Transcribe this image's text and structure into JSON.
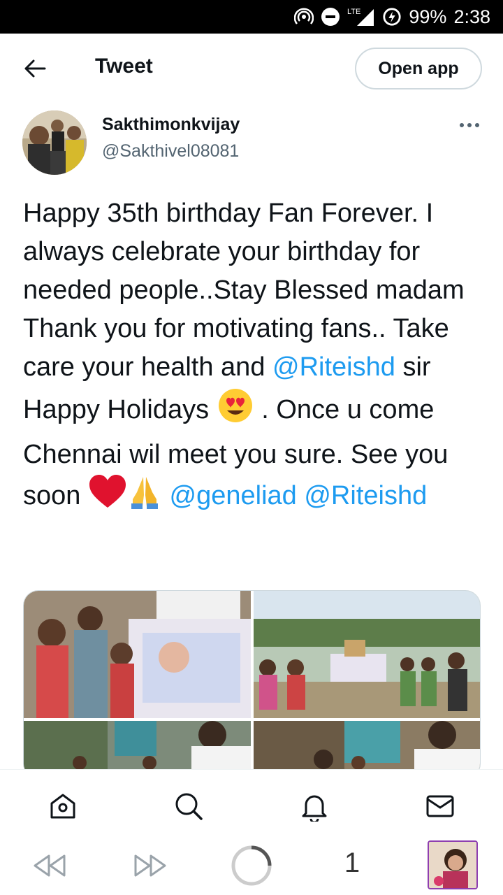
{
  "status_bar": {
    "network": "LTE",
    "battery": "99%",
    "time": "2:38"
  },
  "header": {
    "title": "Tweet",
    "open_app_label": "Open app"
  },
  "author": {
    "display_name": "Sakthimonkvijay",
    "handle": "@Sakthivel08081"
  },
  "tweet": {
    "segments": [
      {
        "type": "text",
        "text": "Happy 35th birthday Fan Forever. I  always celebrate your birthday for needed people..Stay Blessed madam Thank you for motivating fans.. Take care your health and "
      },
      {
        "type": "mention",
        "text": "@Riteishd"
      },
      {
        "type": "text",
        "text": " sir Happy Holidays "
      },
      {
        "type": "emoji",
        "name": "heart-eyes-emoji"
      },
      {
        "type": "text",
        "text": " . Once u come Chennai wil meet you sure. See you soon "
      },
      {
        "type": "emoji",
        "name": "red-heart-emoji"
      },
      {
        "type": "emoji",
        "name": "folded-hands-emoji"
      },
      {
        "type": "text",
        "text": " "
      },
      {
        "type": "mention",
        "text": "@geneliad"
      },
      {
        "type": "text",
        "text": " "
      },
      {
        "type": "mention",
        "text": "@Riteishd"
      }
    ]
  },
  "media": {
    "count": 4,
    "photos": [
      {
        "name": "photo-children-with-poster"
      },
      {
        "name": "photo-group-village-banner"
      },
      {
        "name": "photo-man-distributing"
      },
      {
        "name": "photo-man-giving-gift"
      }
    ]
  },
  "bottom_nav": {
    "items": [
      "home-icon",
      "search-icon",
      "notifications-icon",
      "messages-icon"
    ]
  },
  "browser_bar": {
    "tab_count": "1"
  },
  "colors": {
    "accent": "#1d9bf0",
    "text": "#0f1419",
    "secondary": "#536471",
    "border": "#cfd9de"
  }
}
